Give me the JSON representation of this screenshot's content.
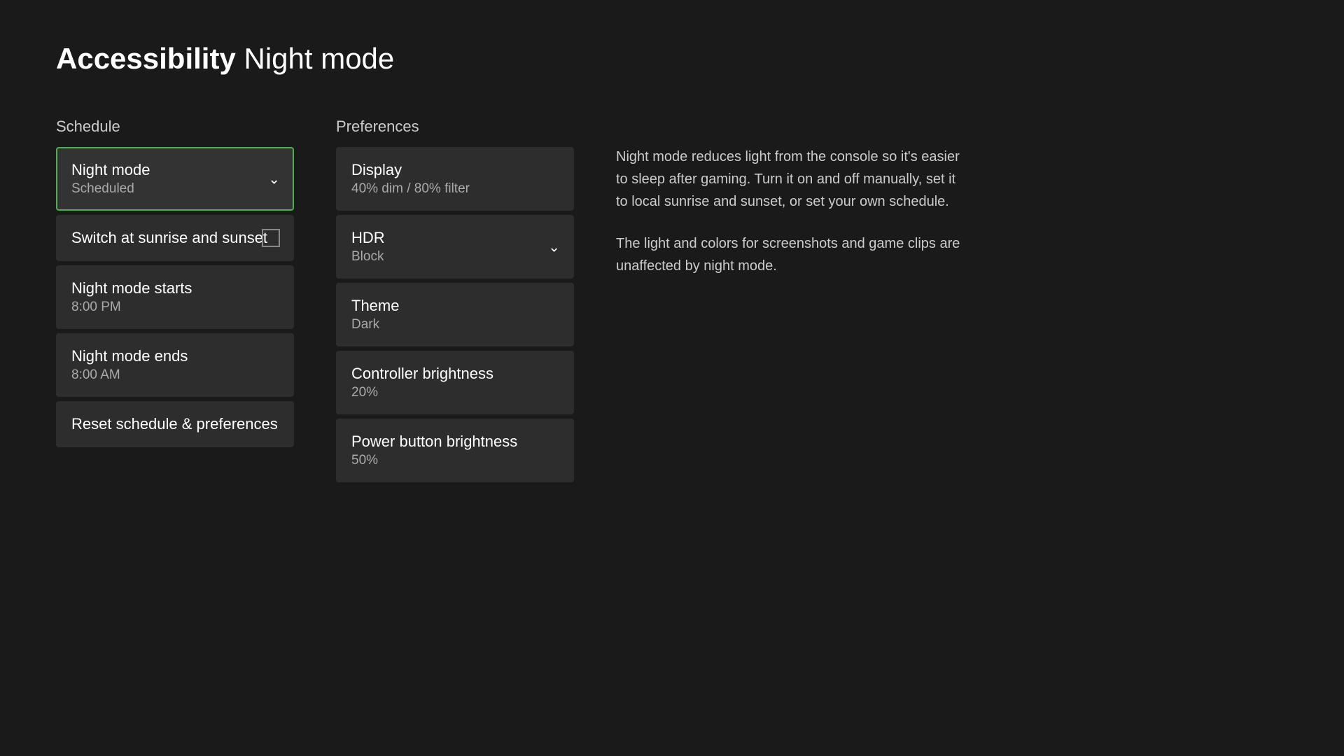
{
  "header": {
    "title_bold": "Accessibility",
    "title_normal": "Night mode"
  },
  "schedule": {
    "column_header": "Schedule",
    "items": [
      {
        "id": "night-mode",
        "title": "Night mode",
        "subtitle": "Scheduled",
        "has_chevron": true,
        "has_checkbox": false,
        "selected": true
      },
      {
        "id": "switch-sunrise",
        "title": "Switch at sunrise and sunset",
        "subtitle": "",
        "has_chevron": false,
        "has_checkbox": true,
        "selected": false
      },
      {
        "id": "night-mode-starts",
        "title": "Night mode starts",
        "subtitle": "8:00 PM",
        "has_chevron": false,
        "has_checkbox": false,
        "selected": false
      },
      {
        "id": "night-mode-ends",
        "title": "Night mode ends",
        "subtitle": "8:00 AM",
        "has_chevron": false,
        "has_checkbox": false,
        "selected": false
      },
      {
        "id": "reset",
        "title": "Reset schedule & preferences",
        "subtitle": "",
        "has_chevron": false,
        "has_checkbox": false,
        "selected": false
      }
    ]
  },
  "preferences": {
    "column_header": "Preferences",
    "items": [
      {
        "id": "display",
        "title": "Display",
        "subtitle": "40% dim / 80% filter",
        "has_chevron": false
      },
      {
        "id": "hdr",
        "title": "HDR",
        "subtitle": "Block",
        "has_chevron": true
      },
      {
        "id": "theme",
        "title": "Theme",
        "subtitle": "Dark",
        "has_chevron": false
      },
      {
        "id": "controller-brightness",
        "title": "Controller brightness",
        "subtitle": "20%",
        "has_chevron": false
      },
      {
        "id": "power-button-brightness",
        "title": "Power button brightness",
        "subtitle": "50%",
        "has_chevron": false
      }
    ]
  },
  "info": {
    "paragraph1": "Night mode reduces light from the console so it's easier to sleep after gaming. Turn it on and off manually, set it to local sunrise and sunset, or set your own schedule.",
    "paragraph2": "The light and colors for screenshots and game clips are unaffected by night mode."
  }
}
